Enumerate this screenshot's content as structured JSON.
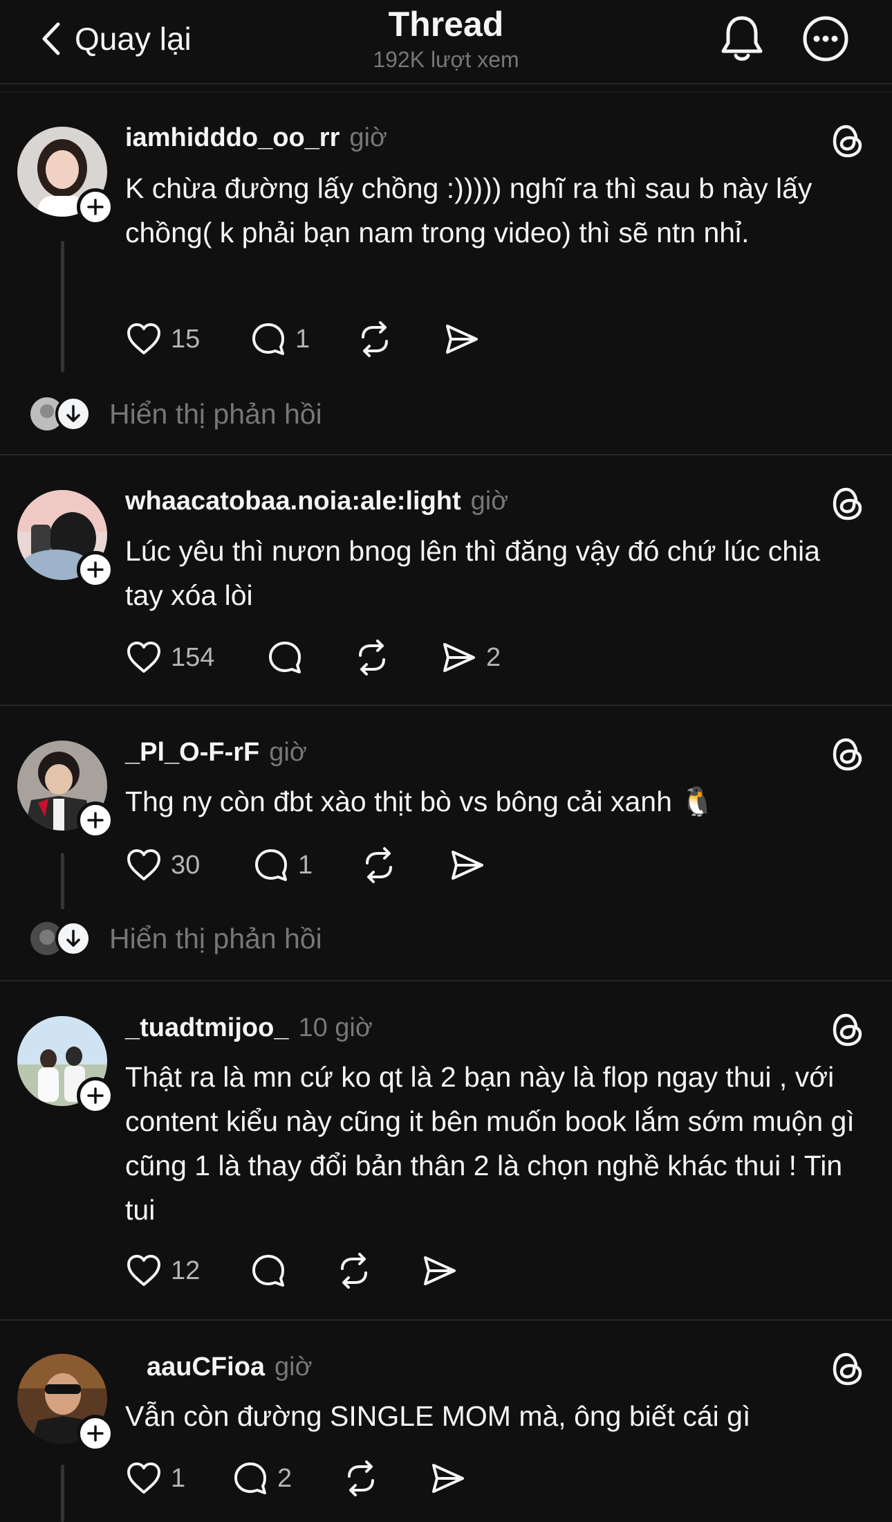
{
  "header": {
    "back_label": "Quay lại",
    "title": "Thread",
    "views": "192K lượt xem",
    "bell_icon": "bell-icon",
    "more_icon": "more-icon"
  },
  "posts": [
    {
      "username": "iamhidddo_oo_rr",
      "time": "giờ",
      "text": "K chừa đường lấy chồng :))))) nghĩ ra thì sau b này lấy chồng( k phải bạn nam trong video) thì sẽ ntn nhỉ.",
      "likes": "15",
      "comments": "1",
      "shares": "",
      "replies_label": "Hiển thị phản hồi"
    },
    {
      "username": "whaacatobaa.noia:ale:light",
      "time": "giờ",
      "text": "Lúc yêu thì nươn bnog lên thì đăng vậy đó chứ lúc chia tay xóa lòi",
      "likes": "154",
      "comments": "",
      "shares": "2"
    },
    {
      "username": "_Pl_O-F-rF",
      "time": "giờ",
      "text": "Thg ny còn đbt xào thịt bò vs bông cải xanh 🐧",
      "likes": "30",
      "comments": "1",
      "shares": "",
      "replies_label": "Hiển thị phản hồi"
    },
    {
      "username": "_tuadtmijoo_",
      "time": "10 giờ",
      "text": "Thật ra là mn cứ ko qt là 2 bạn này là flop ngay thui , với content kiểu này cũng it bên muốn book lắm sớm muộn gì cũng 1 là thay đổi bản thân 2 là chọn nghề khác thui ! Tin tui",
      "likes": "12",
      "comments": "",
      "shares": ""
    },
    {
      "username": "aauCFioa",
      "time": "giờ",
      "text": "Vẫn còn đường SINGLE MOM mà, ông biết cái gì",
      "likes": "1",
      "comments": "2",
      "shares": ""
    }
  ],
  "colors": {
    "background": "#101010",
    "text": "#f3f5f7",
    "muted": "#777777",
    "divider": "#262626"
  }
}
